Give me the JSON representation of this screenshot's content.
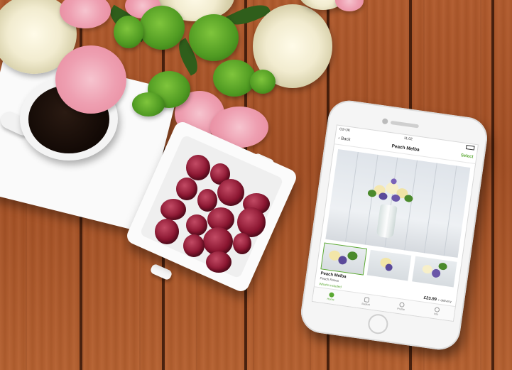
{
  "phone": {
    "status": {
      "carrier": "O2-UK",
      "time": "11:02"
    },
    "nav": {
      "back_label": "Back",
      "title": "Peach Melba",
      "select_label": "Select"
    },
    "product": {
      "name": "Peach Melba",
      "subtitle": "Peach Roses",
      "whats_included": "What's included",
      "price": "£23.99",
      "delivery": "+ delivery"
    },
    "tabs": [
      {
        "label": "Home",
        "icon": "home-flower-icon",
        "active": true
      },
      {
        "label": "Basket",
        "icon": "basket-icon",
        "active": false
      },
      {
        "label": "Profile",
        "icon": "profile-icon",
        "active": false
      },
      {
        "label": "Info",
        "icon": "info-icon",
        "active": false
      }
    ]
  },
  "colors": {
    "accent": "#5aa832",
    "wood": "#a8542a"
  }
}
